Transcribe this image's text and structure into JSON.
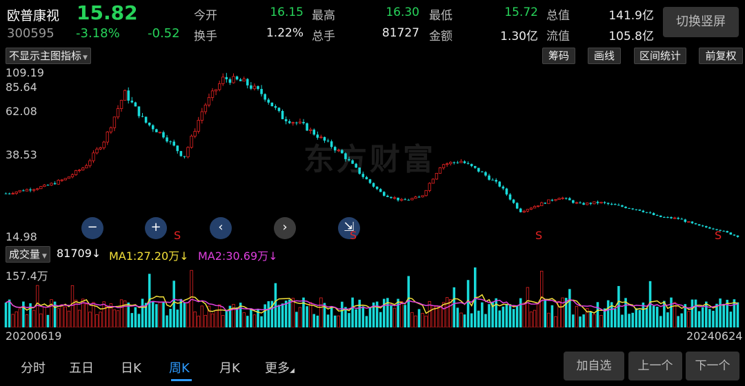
{
  "header": {
    "name": "欧普康视",
    "price": "15.82",
    "code": "300595",
    "change_pct": "-3.18%",
    "change_amt": "-0.52",
    "quotes": [
      {
        "label": "今开",
        "value": "16.15",
        "color": "#27d35a"
      },
      {
        "label": "最高",
        "value": "16.30",
        "color": "#27d35a"
      },
      {
        "label": "最低",
        "value": "15.72",
        "color": "#27d35a"
      },
      {
        "label": "总值",
        "value": "141.9亿",
        "color": "#eeeeee"
      },
      {
        "label": "换手",
        "value": "1.22%",
        "color": "#eeeeee"
      },
      {
        "label": "总手",
        "value": "81727",
        "color": "#eeeeee"
      },
      {
        "label": "金额",
        "value": "1.30亿",
        "color": "#eeeeee"
      },
      {
        "label": "流值",
        "value": "105.8亿",
        "color": "#eeeeee"
      }
    ],
    "switch_label": "切换竖屏"
  },
  "toolbar": {
    "indicator": "不显示主图指标",
    "chips_label": "筹码",
    "draw_label": "画线",
    "range_label": "区间统计",
    "adjust_label": "前复权"
  },
  "chart_data": {
    "type": "candlestick",
    "period": "weekly",
    "y_ticks": [
      "109.19",
      "85.64",
      "62.08",
      "38.53",
      "14.98"
    ],
    "start_date": "20200619",
    "end_date": "20240624",
    "price_trend": [
      40,
      42,
      44,
      48,
      55,
      70,
      96,
      80,
      72,
      60,
      88,
      104,
      102,
      95,
      82,
      78,
      70,
      62,
      50,
      40,
      36,
      38,
      56,
      58,
      52,
      44,
      30,
      34,
      38,
      34,
      35,
      33,
      31,
      27,
      26,
      22,
      20,
      16
    ],
    "last_price": 15.82,
    "volume": {
      "label": "成交量",
      "value": "81709↓",
      "ma1": "MA1:27.20万↓",
      "ma2": "MA2:30.69万↓",
      "y_max_label": "157.4万",
      "ma1_color": "#f5e23a",
      "ma2_color": "#e040e0"
    },
    "up_color": "#e82323",
    "down_color": "#19dada"
  },
  "controls": {
    "zoom_out": "−",
    "zoom_in": "+",
    "prev": "‹",
    "next": "›",
    "reset": "⇲"
  },
  "s_marker": "S",
  "watermark": "东方财富",
  "tabs": [
    "分时",
    "五日",
    "日K",
    "周K",
    "月K",
    "更多"
  ],
  "buttons": {
    "add": "加自选",
    "prev": "上一个",
    "next": "下一个"
  }
}
